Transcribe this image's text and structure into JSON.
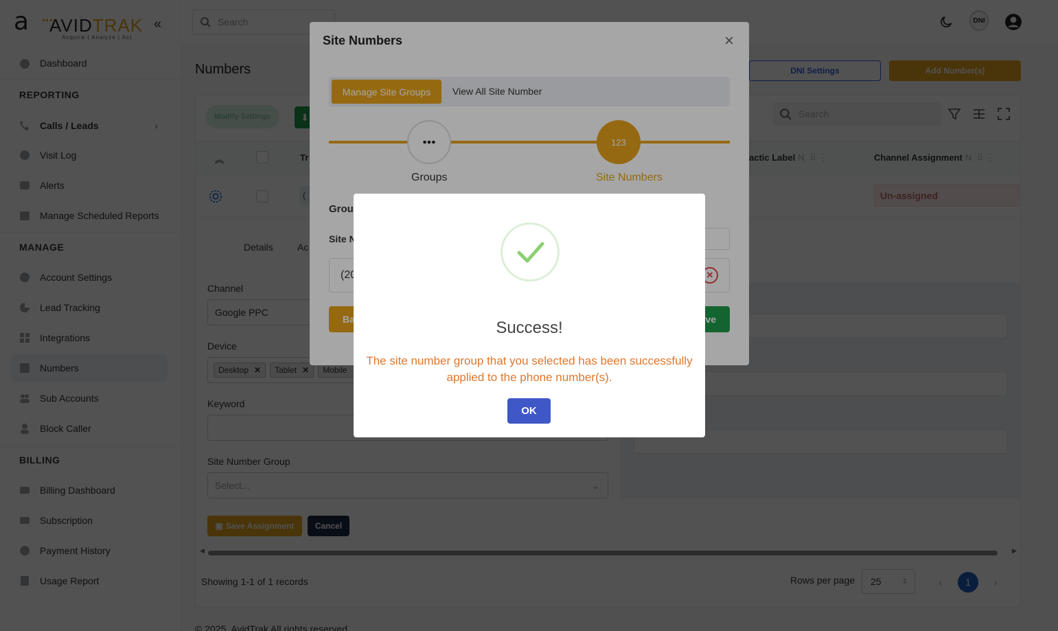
{
  "brand": {
    "logo_mark": "a",
    "logo_text_main": "AVID",
    "logo_text_accent": "TRAK",
    "tagline": "Acquire  |  Analyze  |  Act"
  },
  "sidebar": {
    "collapse_icon": "«",
    "items": [
      {
        "label": "Dashboard",
        "icon": "dashboard-icon"
      },
      {
        "label": "Calls / Leads",
        "icon": "phone-icon",
        "chevron": "›"
      },
      {
        "label": "Visit Log",
        "icon": "globe-icon"
      },
      {
        "label": "Alerts",
        "icon": "alert-icon"
      },
      {
        "label": "Manage Scheduled Reports",
        "icon": "calendar-icon"
      },
      {
        "label": "Account Settings",
        "icon": "gear-icon"
      },
      {
        "label": "Lead Tracking",
        "icon": "pie-icon"
      },
      {
        "label": "Integrations",
        "icon": "grid-icon"
      },
      {
        "label": "Numbers",
        "icon": "hash-icon"
      },
      {
        "label": "Sub Accounts",
        "icon": "users-icon"
      },
      {
        "label": "Block Caller",
        "icon": "user-block-icon"
      },
      {
        "label": "Billing Dashboard",
        "icon": "card-icon"
      },
      {
        "label": "Subscription",
        "icon": "subscription-icon"
      },
      {
        "label": "Payment History",
        "icon": "dollar-icon"
      },
      {
        "label": "Usage Report",
        "icon": "report-icon"
      }
    ],
    "sections": {
      "reporting": "REPORTING",
      "manage": "MANAGE",
      "billing": "BILLING"
    }
  },
  "topbar": {
    "search_placeholder": "Search",
    "dni_label": "DNI"
  },
  "page": {
    "title": "Numbers",
    "dni_settings_label": "DNI Settings",
    "add_number_label": "Add Number(s)"
  },
  "table": {
    "modify_settings_label": "Modify Settings",
    "search_placeholder": "Search",
    "col_tr": "Tr",
    "col_tactic": "actic Label",
    "col_channel": "Channel Assignment",
    "col_suffix": "N",
    "row_prefix": "(",
    "row_channel": "Un-assigned",
    "tabs": {
      "details": "Details",
      "ac": "Ac"
    },
    "form": {
      "channel_label": "Channel",
      "channel_value": "Google PPC",
      "device_label": "Device",
      "devices": [
        "Desktop",
        "Tablet",
        "Mobile"
      ],
      "keyword_label": "Keyword",
      "site_group_label": "Site Number Group",
      "site_group_placeholder": "Select...",
      "save_assignment": "Save Assignment",
      "cancel": "Cancel"
    },
    "records": "Showing 1-1 of 1 records",
    "rows_per_page_label": "Rows per page",
    "rows_per_page_value": "25",
    "current_page": "1"
  },
  "footer": "© 2025, AvidTrak All rights reserved.",
  "modal": {
    "title": "Site Numbers",
    "close": "×",
    "seg_active": "Manage Site Groups",
    "seg_other": "View All Site Number",
    "step1_label": "Groups",
    "step2_icon_text": "123",
    "step2_label": "Site Numbers",
    "group_label": "Grou",
    "site_number_label": "Site N",
    "row_value": "(20",
    "back_label": "Ba",
    "save_label": "ve"
  },
  "alert": {
    "title": "Success!",
    "message": "The site number group that you selected has been successfully applied to the phone number(s).",
    "ok_label": "OK",
    "accent": "#e0772c",
    "ok_color": "#3f57c7"
  }
}
